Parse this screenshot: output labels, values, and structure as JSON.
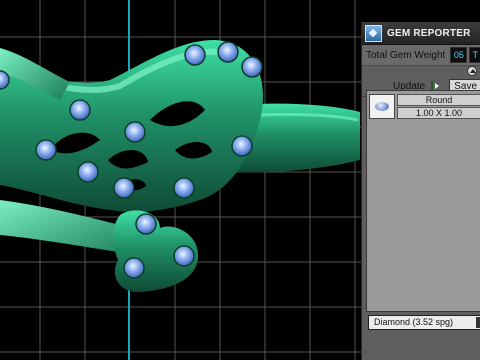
{
  "viewport": {
    "background": "#000000",
    "grid_color": "#555555",
    "axis_vertical_color": "#1aa7b8",
    "axis_horizontal_color": "#c81e1e",
    "model_color": "#1f8f66",
    "gem_color": "#5b8fe0"
  },
  "gem_reporter": {
    "title": "GEM REPORTER",
    "total_weight_label": "Total Gem Weight",
    "total_weight_value": "05",
    "total_weight_unit_partial": "T",
    "update_label": "Update",
    "save_label": "Save",
    "items": [
      {
        "shape": "Round",
        "size": "1.00 X 1.00",
        "icon": "round-gem-icon"
      }
    ],
    "material": "Diamond     (3.52 spg)"
  }
}
